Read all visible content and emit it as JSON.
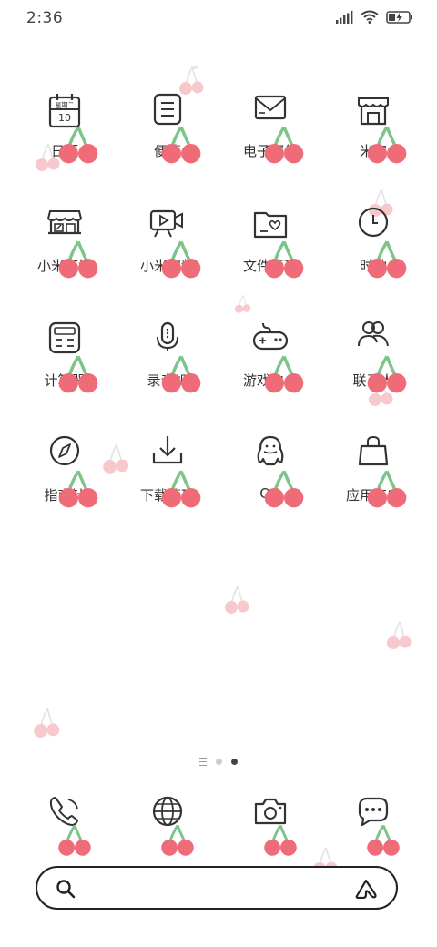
{
  "status_bar": {
    "time": "2:36"
  },
  "apps": [
    {
      "label": "日历",
      "icon": "calendar-icon",
      "calendar_text": "星期二",
      "calendar_day": "10"
    },
    {
      "label": "便签",
      "icon": "notes-icon"
    },
    {
      "label": "电子邮件",
      "icon": "mail-icon"
    },
    {
      "label": "米家",
      "icon": "mijia-store-icon"
    },
    {
      "label": "小米商城",
      "icon": "mi-store-icon"
    },
    {
      "label": "小米视频",
      "icon": "video-icon"
    },
    {
      "label": "文件管理",
      "icon": "file-manager-icon"
    },
    {
      "label": "时钟",
      "icon": "clock-icon"
    },
    {
      "label": "计算器",
      "icon": "calculator-icon"
    },
    {
      "label": "录音机",
      "icon": "microphone-icon"
    },
    {
      "label": "游戏中心",
      "icon": "gamepad-icon"
    },
    {
      "label": "联系人",
      "icon": "contacts-icon"
    },
    {
      "label": "指南针",
      "icon": "compass-icon"
    },
    {
      "label": "下载管理",
      "icon": "download-icon"
    },
    {
      "label": "QQ",
      "icon": "qq-icon"
    },
    {
      "label": "应用商店",
      "icon": "app-store-icon"
    }
  ],
  "pager": {
    "pages": 2,
    "active": 2
  },
  "dock": [
    "phone-icon",
    "browser-icon",
    "camera-icon",
    "messages-icon"
  ],
  "search": {
    "placeholder": ""
  },
  "colors": {
    "cherry": "#ef6b78",
    "cherry_faded": "#f7c9cd",
    "stem": "#7cc48a",
    "icon_stroke": "#333333"
  }
}
